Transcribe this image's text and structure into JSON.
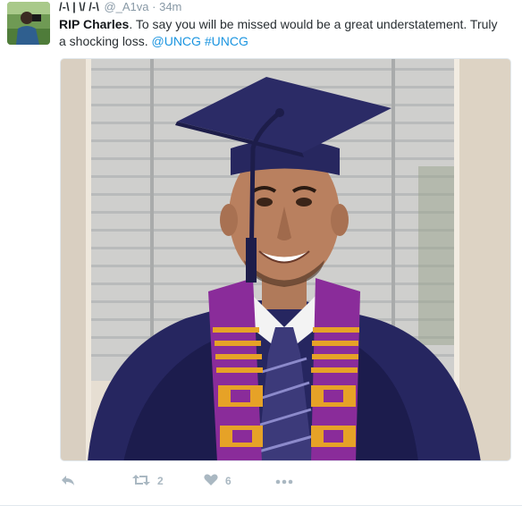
{
  "author": {
    "fullname": "/-\\ | \\/ /-\\",
    "username": "@_A1va",
    "separator": "·",
    "time": "34m"
  },
  "tweet": {
    "bold_name": "RIP Charles",
    "text_part1": ". To say you will be missed would be a great understatement. Truly a shocking loss. ",
    "mention": "@UNCG",
    "space": " ",
    "hashtag": "#UNCG"
  },
  "actions": {
    "reply_icon": "reply-icon",
    "retweet_icon": "retweet-icon",
    "retweet_count": "2",
    "like_icon": "heart-icon",
    "like_count": "6",
    "more_icon": "more-dots-icon"
  },
  "colors": {
    "link": "#1b95e0",
    "meta": "#8899a6",
    "action": "#aab8c2"
  }
}
